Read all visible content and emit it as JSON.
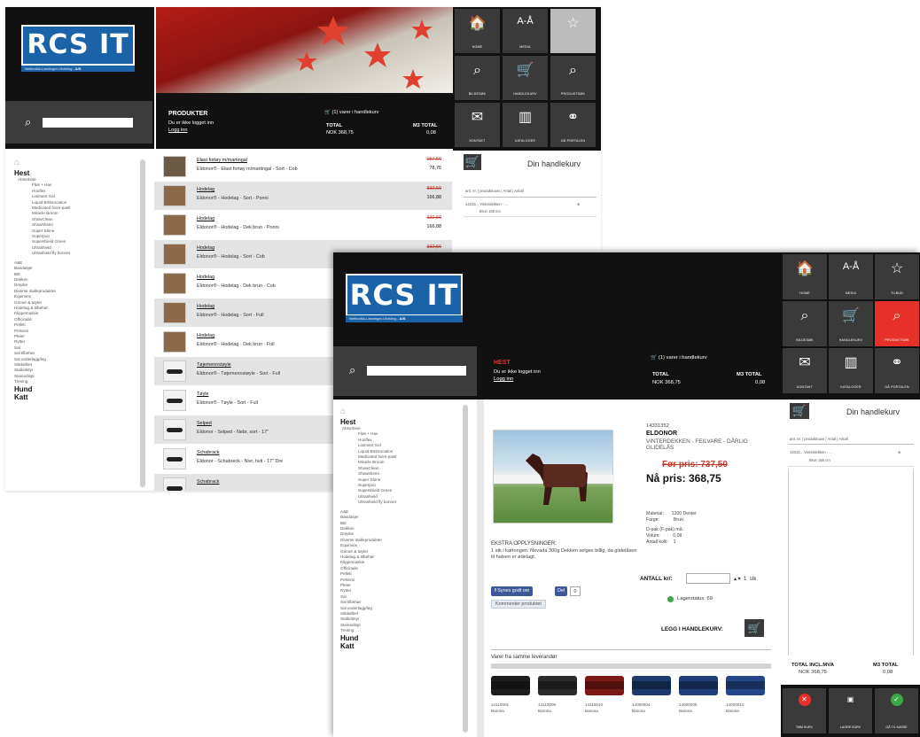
{
  "brand": {
    "name": "RCS IT",
    "tagline": "Nettbutikk-Løsninger-Utvikling",
    "suffix": "- A/S"
  },
  "tiles1": [
    {
      "label": "HOME",
      "icon": "home-icon",
      "glyph": "🏠"
    },
    {
      "label": "MEDIA",
      "icon": "text-size-icon",
      "glyph": "A-Å"
    },
    {
      "label": "",
      "icon": "star-icon",
      "glyph": "☆"
    },
    {
      "label": "BILDESØK",
      "icon": "image-search-icon",
      "glyph": "⌕"
    },
    {
      "label": "HANDLEKURV",
      "icon": "cart-icon",
      "glyph": "🛒"
    },
    {
      "label": "PRODUKTSØK",
      "icon": "search-icon",
      "glyph": "⌕"
    },
    {
      "label": "KONTAKT",
      "icon": "mail-icon",
      "glyph": "✉"
    },
    {
      "label": "KATALOGER",
      "icon": "catalog-icon",
      "glyph": "▥"
    },
    {
      "label": "GÅ PORTALEN",
      "icon": "portal-icon",
      "glyph": "⚭"
    }
  ],
  "tiles2": [
    {
      "label": "HOME",
      "icon": "home-icon",
      "glyph": "🏠"
    },
    {
      "label": "MEDIA",
      "icon": "text-size-icon",
      "glyph": "A-Å"
    },
    {
      "label": "TILBUD",
      "icon": "star-icon",
      "glyph": "☆"
    },
    {
      "label": "BILDESØK",
      "icon": "image-search-icon",
      "glyph": "⌕"
    },
    {
      "label": "HANDLEKURV",
      "icon": "cart-icon",
      "glyph": "🛒"
    },
    {
      "label": "PRODUKTSØK",
      "icon": "search-icon",
      "glyph": "⌕"
    },
    {
      "label": "KONTAKT",
      "icon": "mail-icon",
      "glyph": "✉"
    },
    {
      "label": "KATALOGER",
      "icon": "catalog-icon",
      "glyph": "▥"
    },
    {
      "label": "GÅ PORTALEN",
      "icon": "portal-icon",
      "glyph": "⚭"
    }
  ],
  "header1": {
    "title": "PRODUKTER",
    "line1": "Du er ikke logget inn",
    "login": "Logg inn",
    "cart": "(1) varer i handlekurv",
    "total_label": "TOTAL",
    "total": "NOK 368,75",
    "m3_label": "M3 TOTAL",
    "m3": "0,08"
  },
  "header2": {
    "title": "HEST",
    "line1": "Du er ikke logget inn",
    "login": "Logg inn",
    "cart": "(1) varer i handlekurv",
    "total_label": "TOTAL",
    "total": "NOK 368,75",
    "m3_label": "M3 TOTAL",
    "m3": "0,08"
  },
  "sidebar": {
    "hest": "Hest",
    "hest_sub": "Absorbine",
    "abs_items": [
      "Fløs + Hav",
      "Hooflex",
      "Liniment Gel",
      "Liquid Bmbrocation",
      "Medicated hvim-pastl",
      "Miracle Broom",
      "ShowClean",
      "Showsheen",
      "Super Shine",
      "Superpoo",
      "Supershield Green",
      "Ultrashield",
      "Ultrashield fly bonnet"
    ],
    "items": [
      "A&E",
      "Bandasjer",
      "Bitt",
      "Dekken",
      "Drepbe",
      "Diverse stalleprodukter",
      "Equimins",
      "Grimer & tøyler",
      "Hodelag & tilbehør",
      "Klippemaskin",
      "Officinalis",
      "Pelleti",
      "Pertenti",
      "Pleier",
      "Rytter",
      "Sal",
      "Sal tilbehør",
      "Sal underlagg/leg",
      "Stikkelbet",
      "Stalluttstyr",
      "Steinedispl",
      "Trening"
    ],
    "hund": "Hund",
    "katt": "Katt"
  },
  "products": [
    {
      "name": "Elast fortøy m/martingal",
      "desc": "Eldonor® - Elast fortøy m/martingal - Sort - Cob",
      "old": "157,50",
      "new": "78,75"
    },
    {
      "name": "Hodelag",
      "desc": "Eldonor® - Hodelag - Sort - Ponni",
      "old": "332,50",
      "new": "166,88"
    },
    {
      "name": "Hodelag",
      "desc": "Eldonor® - Hodelag - Dek brun - Ponni",
      "old": "332,50",
      "new": "166,88"
    },
    {
      "name": "Hodelag",
      "desc": "Eldonor® - Hodelag - Sort - Cob",
      "old": "332,50",
      "new": ""
    },
    {
      "name": "Hodelag",
      "desc": "Eldonor® - Hodelag - Dek brun - Cob",
      "old": "",
      "new": ""
    },
    {
      "name": "Hodelag",
      "desc": "Eldonor® - Hodelag - Sort - Full",
      "old": "",
      "new": ""
    },
    {
      "name": "Hodelag",
      "desc": "Eldonor® - Hodelag - Dek brun - Full",
      "old": "",
      "new": ""
    },
    {
      "name": "Tøjemennstøyle",
      "desc": "Eldonor® - Tøjemennstøyle - Sort - Full",
      "old": "",
      "new": ""
    },
    {
      "name": "Tøyle",
      "desc": "Eldonor® - Tøyle - Sort - Full",
      "old": "",
      "new": ""
    },
    {
      "name": "Selped",
      "desc": "Eldonor - Selped - Nebr, sort - 17\"",
      "old": "",
      "new": ""
    },
    {
      "name": "Schabrack",
      "desc": "Eldonor - Schabreck - Nivr, hvit - 17\" Dre",
      "old": "",
      "new": ""
    },
    {
      "name": "Schabrack",
      "desc": "",
      "old": "",
      "new": ""
    }
  ],
  "cart1": {
    "title": "Din handlekurv",
    "headers": "ant. nr. | produktnavn | Antal | Antall",
    "row": "14315... Vinterdekken - ...",
    "sub": "Brun 155 cm"
  },
  "cart2": {
    "title": "Din handlekurv",
    "headers": "ant. nr. | produktnavn | Antal | Antall",
    "row": "14315... Vinterdekken - ...",
    "sub": "Brun 155 cm",
    "total_label": "TOTAL INCL.MVA",
    "total": "NOK 368,75",
    "m3_label": "M3 TOTAL",
    "m3": "0,08"
  },
  "product": {
    "sku": "14331352",
    "brand": "ELDONOR",
    "name": "VINTERDEKKEN - FEILVARE - DÅRLIG GLIDELÅS",
    "old_price": "Før pris: 737,50",
    "new_price": "Nå pris: 368,75",
    "spec_material_label": "Material:",
    "spec_material": "1200 Denier",
    "spec_color_label": "Farge:",
    "spec_color": "Brun",
    "spec_pak_label": "D-pak (F-pak) må:",
    "spec_volume_label": "Volum:",
    "spec_volume": "0,08",
    "spec_qty_label": "Antall kolli:",
    "spec_qty": "1",
    "extra_title": "EKSTRA OPPLYSNINGER:",
    "extra_text": "1 stk i kartongen. Nevada 300g Dekken selges billig, da glidelåsen til halsen er ødelagt.",
    "fb_like": "Synes godt om",
    "fb_share": "Del",
    "fb_count": "0",
    "comment": "Kommenter produktet",
    "qty_label": "ANTALL kr/:",
    "qty_unit": "stk",
    "stock": "Lagerstatus: 69",
    "add_to_cart": "LEGG I HANDLEKURV:",
    "related_title": "Varer fra samme leverandør",
    "related": [
      {
        "sku": "14110001",
        "brand": "Barona"
      },
      {
        "sku": "14110006",
        "brand": "Barona"
      },
      {
        "sku": "14110010",
        "brand": "Barona"
      },
      {
        "sku": "14000004",
        "brand": "Barona"
      },
      {
        "sku": "14000005",
        "brand": "Barona"
      },
      {
        "sku": "14000010",
        "brand": "Barona"
      }
    ]
  },
  "bottom_buttons": [
    {
      "label": "TØM KURV",
      "icon": "empty-cart-icon",
      "color": "#e8302a",
      "glyph": "✕"
    },
    {
      "label": "LAGRE KURV",
      "icon": "save-cart-icon",
      "color": "#3a3a3a",
      "glyph": "▣"
    },
    {
      "label": "GÅ TIL KASSE",
      "icon": "checkout-icon",
      "color": "#3aa845",
      "glyph": "✓"
    }
  ],
  "colors": {
    "accent": "#e8302a",
    "brand_blue": "#1a63a8",
    "dark": "#111111",
    "tile": "#3a3a3a"
  }
}
